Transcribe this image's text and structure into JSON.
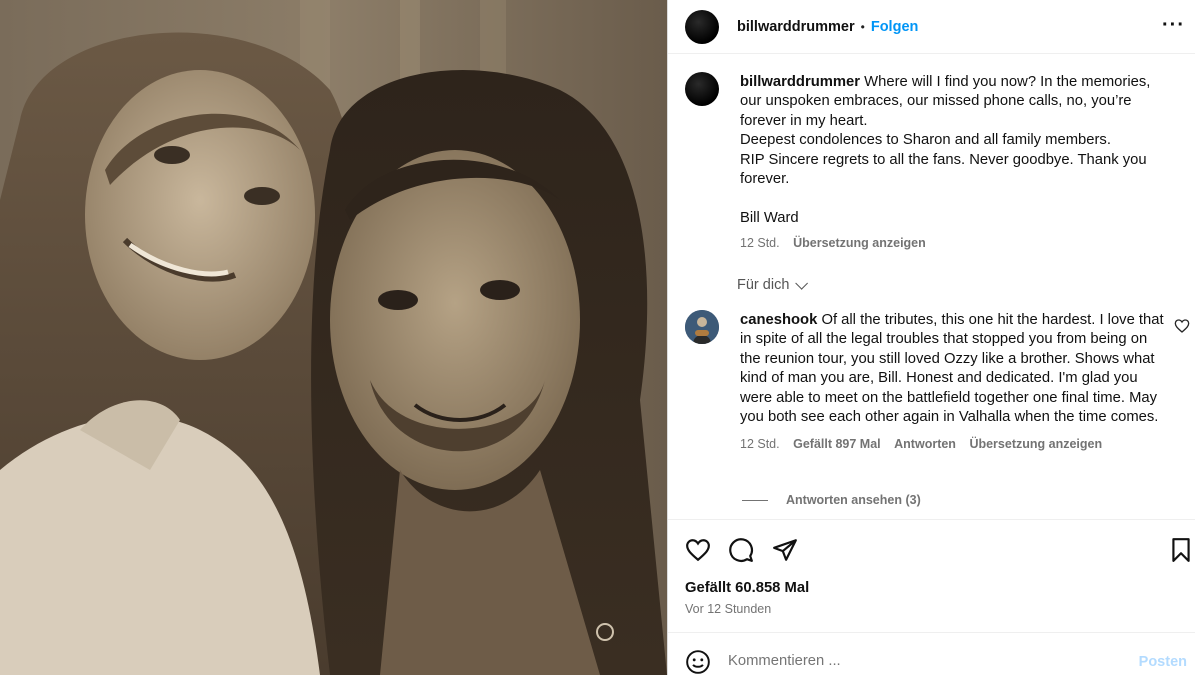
{
  "header": {
    "username": "billwarddrummer",
    "separator": "•",
    "follow_label": "Folgen",
    "more_label": "···"
  },
  "caption": {
    "username": "billwarddrummer",
    "line1": "Where will I find you now? In the memories, our unspoken embraces, our missed phone calls, no, you’re forever in my heart.",
    "line2": "Deepest condolences to Sharon and all family members.",
    "line3": "RIP Sincere regrets to all the fans. Never goodbye. Thank you forever.",
    "signature": "Bill Ward",
    "time": "12 Std.",
    "translate": "Übersetzung anzeigen"
  },
  "filter": {
    "label": "Für dich"
  },
  "comment": {
    "username": "caneshook",
    "text": "Of all the tributes, this one hit the hardest. I love that in spite of all the legal troubles that stopped you from being on the reunion tour, you still loved Ozzy like a brother. Shows what kind of man you are, Bill. Honest and dedicated. I'm glad you were able to meet on the battlefield together one final time. May you both see each other again in Valhalla when the time comes.",
    "time": "12 Std.",
    "likes": "Gefällt 897 Mal",
    "reply": "Antworten",
    "translate": "Übersetzung anzeigen",
    "view_replies": "Antworten ansehen (3)"
  },
  "post": {
    "likes": "Gefällt 60.858 Mal",
    "ago": "Vor 12 Stunden"
  },
  "compose": {
    "placeholder": "Kommentieren ...",
    "post_label": "Posten"
  },
  "colors": {
    "accent": "#0095f6",
    "muted": "#737373",
    "post_disabled": "#b3dbff",
    "photo_sepia": "#5a4e40"
  }
}
